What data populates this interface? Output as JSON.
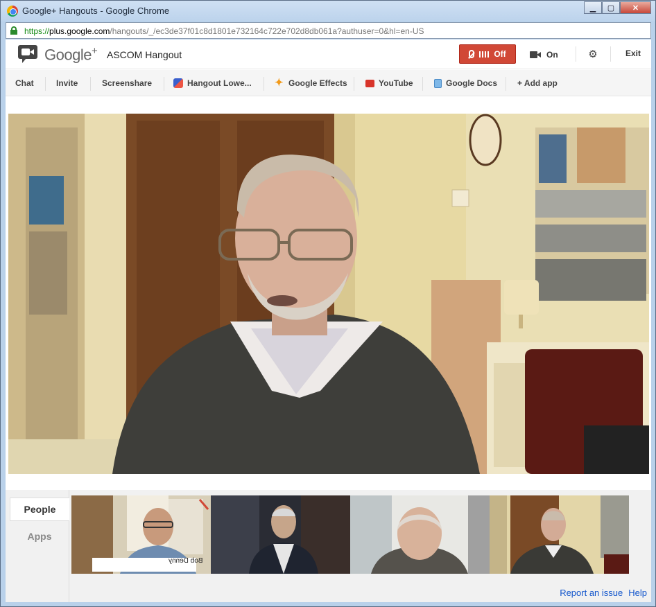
{
  "window": {
    "title": "Google+ Hangouts - Google Chrome",
    "buttons": {
      "minimize": "▁",
      "maximize": "▢",
      "close": "✕"
    }
  },
  "address": {
    "scheme": "https://",
    "host": "plus.google.com",
    "path": "/hangouts/_/ec3de37f01c8d1801e732164c722e702d8db061a?authuser=0&hl=en-US"
  },
  "header": {
    "brand": "Google",
    "brand_plus": "+",
    "hangout_name": "ASCOM Hangout",
    "mic_label": "Off",
    "camera_label": "On",
    "exit_label": "Exit"
  },
  "apps": [
    {
      "label": "Chat",
      "icon": ""
    },
    {
      "label": "Invite",
      "icon": ""
    },
    {
      "label": "Screenshare",
      "icon": ""
    },
    {
      "label": "Hangout Lowe...",
      "icon": "hangout-lower-third-icon"
    },
    {
      "label": "Google Effects",
      "icon": "effects-sparkle-icon"
    },
    {
      "label": "YouTube",
      "icon": "youtube-icon"
    },
    {
      "label": "Google Docs",
      "icon": "docs-icon"
    },
    {
      "label": "+ Add app",
      "icon": ""
    }
  ],
  "sidebar": {
    "tabs": [
      "People",
      "Apps"
    ]
  },
  "participants": [
    {
      "name_overlay": "Bob Denny",
      "muted": true
    },
    {
      "name_overlay": "",
      "muted": false
    },
    {
      "name_overlay": "",
      "muted": false
    },
    {
      "name_overlay": "",
      "muted": false,
      "speaking": true
    }
  ],
  "footer": {
    "report": "Report an issue",
    "help": "Help"
  },
  "colors": {
    "mic_off_red": "#d14836",
    "speaking_green": "#3ca33c",
    "link_blue": "#1155cc"
  }
}
